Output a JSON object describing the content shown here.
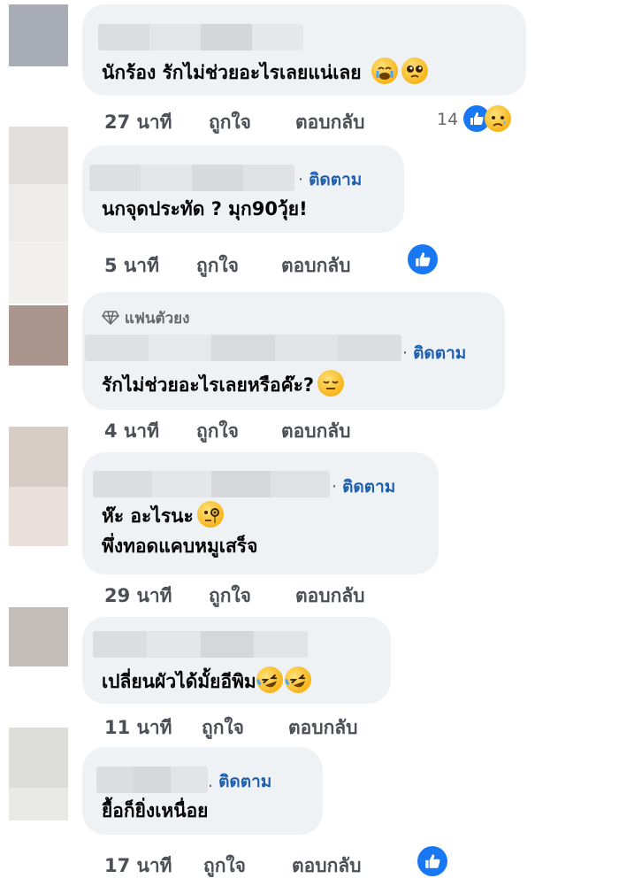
{
  "comments": [
    {
      "text": [
        "นักร้อง รักไม่ช่วยอะไรเลยแน่เลย"
      ],
      "time": "27 นาที",
      "like": "ถูกใจ",
      "reply": "ตอบกลับ",
      "reaction_count": "14",
      "emojis": [
        "crying-face-icon",
        "pleading-face-icon"
      ]
    },
    {
      "follow": "ติดตาม",
      "text": [
        "นกจุดประทัด ? มุก90วุ้ย!"
      ],
      "time": "5 นาที",
      "like": "ถูกใจ",
      "reply": "ตอบกลับ"
    },
    {
      "badge": "แฟนตัวยง",
      "follow": "ติดตาม",
      "text": [
        "รักไม่ช่วยอะไรเลยหรือค๊ะ?"
      ],
      "time": "4 นาที",
      "like": "ถูกใจ",
      "reply": "ตอบกลับ",
      "emojis": [
        "relieved-face-icon"
      ]
    },
    {
      "follow": "ติดตาม",
      "text": [
        "ห๊ะ อะไรนะ",
        "พึ่งทอดแคบหมูเสร็จ"
      ],
      "time": "29 นาที",
      "like": "ถูกใจ",
      "reply": "ตอบกลับ",
      "emojis": [
        "monocle-face-icon"
      ]
    },
    {
      "text": [
        "เปลี่ยนผัวได้มั้ยอีพิม"
      ],
      "time": "11 นาที",
      "like": "ถูกใจ",
      "reply": "ตอบกลับ",
      "emojis": [
        "rolling-laughing-icon",
        "rolling-laughing-icon"
      ]
    },
    {
      "follow": "ติดตาม",
      "text": [
        "ยื้อก็ยิ่งเหนื่อย"
      ],
      "time": "17 นาที",
      "like": "ถูกใจ",
      "reply": "ตอบกลับ"
    }
  ],
  "colors": {
    "bubble": "#eff2f5",
    "follow": "#1f5fb0",
    "like_blue": "#1877f2",
    "action_text": "#4b4f56"
  }
}
